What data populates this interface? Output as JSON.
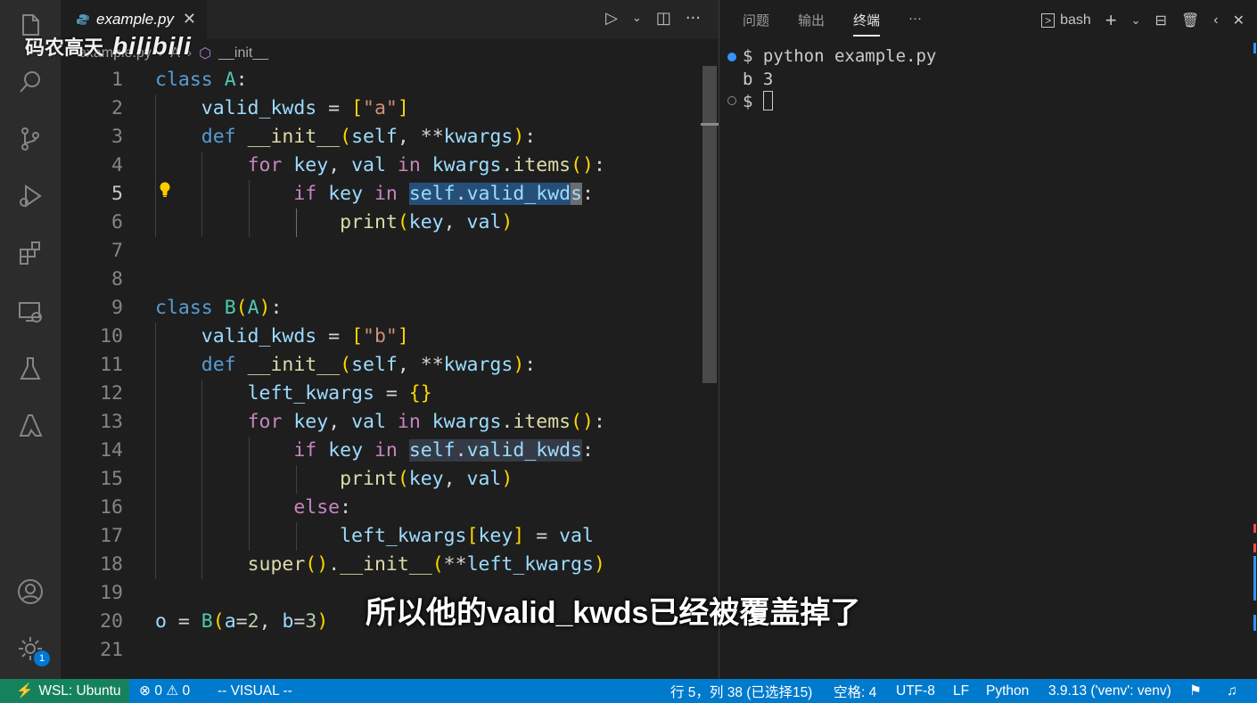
{
  "watermark": {
    "text": "码农高天",
    "logo": "bilibili"
  },
  "tab": {
    "filename": "example.py"
  },
  "breadcrumb": {
    "file": "example.py",
    "class": "A",
    "method": "__init__"
  },
  "editor": {
    "current_line": 5,
    "line_numbers": [
      "1",
      "2",
      "3",
      "4",
      "5",
      "6",
      "7",
      "8",
      "9",
      "10",
      "11",
      "12",
      "13",
      "14",
      "15",
      "16",
      "17",
      "18",
      "19",
      "20",
      "21"
    ],
    "code_lines": [
      "class A:",
      "    valid_kwds = [\"a\"]",
      "    def __init__(self, **kwargs):",
      "        for key, val in kwargs.items():",
      "            if key in self.valid_kwds:",
      "                print(key, val)",
      "",
      "",
      "class B(A):",
      "    valid_kwds = [\"b\"]",
      "    def __init__(self, **kwargs):",
      "        left_kwargs = {}",
      "        for key, val in kwargs.items():",
      "            if key in self.valid_kwds:",
      "                print(key, val)",
      "            else:",
      "                left_kwargs[key] = val",
      "        super().__init__(**left_kwargs)",
      "",
      "o = B(a=2, b=3)",
      ""
    ]
  },
  "panel": {
    "tabs": [
      "问题",
      "输出",
      "终端"
    ],
    "active_tab": "终端",
    "more": "···",
    "shell": "bash",
    "terminal": {
      "prompt": "$",
      "command": "python example.py",
      "output": "b 3"
    }
  },
  "subtitle": "所以他的valid_kwds已经被覆盖掉了",
  "activity_badge": "1",
  "status": {
    "remote": "WSL: Ubuntu",
    "errors": "0",
    "warnings": "0",
    "mode": "-- VISUAL --",
    "position": "行 5，列 38 (已选择15)",
    "spaces": "空格: 4",
    "encoding": "UTF-8",
    "eol": "LF",
    "language": "Python",
    "interpreter": "3.9.13 ('venv': venv)"
  },
  "colors": {
    "status_bar": "#007acc",
    "remote": "#16825d",
    "selection": "#264f78"
  }
}
